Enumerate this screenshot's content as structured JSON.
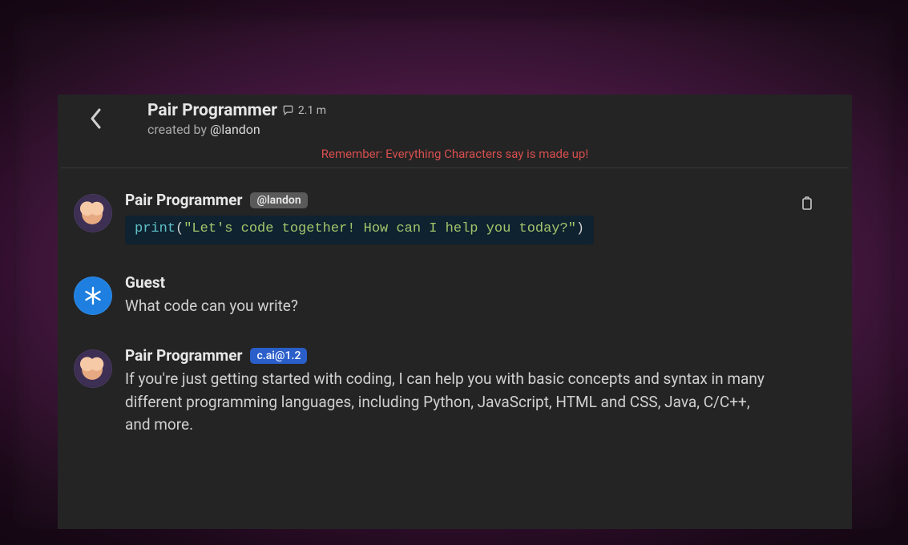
{
  "header": {
    "title": "Pair Programmer",
    "interaction_count": "2.1 m",
    "created_by_prefix": "created by ",
    "creator_handle": "@landon"
  },
  "disclaimer": "Remember: Everything Characters say is made up!",
  "icons": {
    "back": "chevron-left-icon",
    "chat": "speech-bubble-icon",
    "clipboard": "clipboard-icon",
    "guest_star": "asterisk-icon"
  },
  "messages": [
    {
      "author": "Pair Programmer",
      "tag": "@landon",
      "tag_style": "gray",
      "avatar": "bot",
      "code": {
        "fn": "print",
        "open": "(",
        "string": "\"Let's code together! How can I help you today?\"",
        "close": ")"
      },
      "has_clipboard": true
    },
    {
      "author": "Guest",
      "avatar": "guest",
      "text": "What code can you write?"
    },
    {
      "author": "Pair Programmer",
      "tag": "c.ai@1.2",
      "tag_style": "blue",
      "avatar": "bot",
      "text": "If you're just getting started with coding, I can help you with basic concepts and syntax in many different programming languages, including Python, JavaScript, HTML and CSS, Java, C/C++, and more."
    }
  ]
}
